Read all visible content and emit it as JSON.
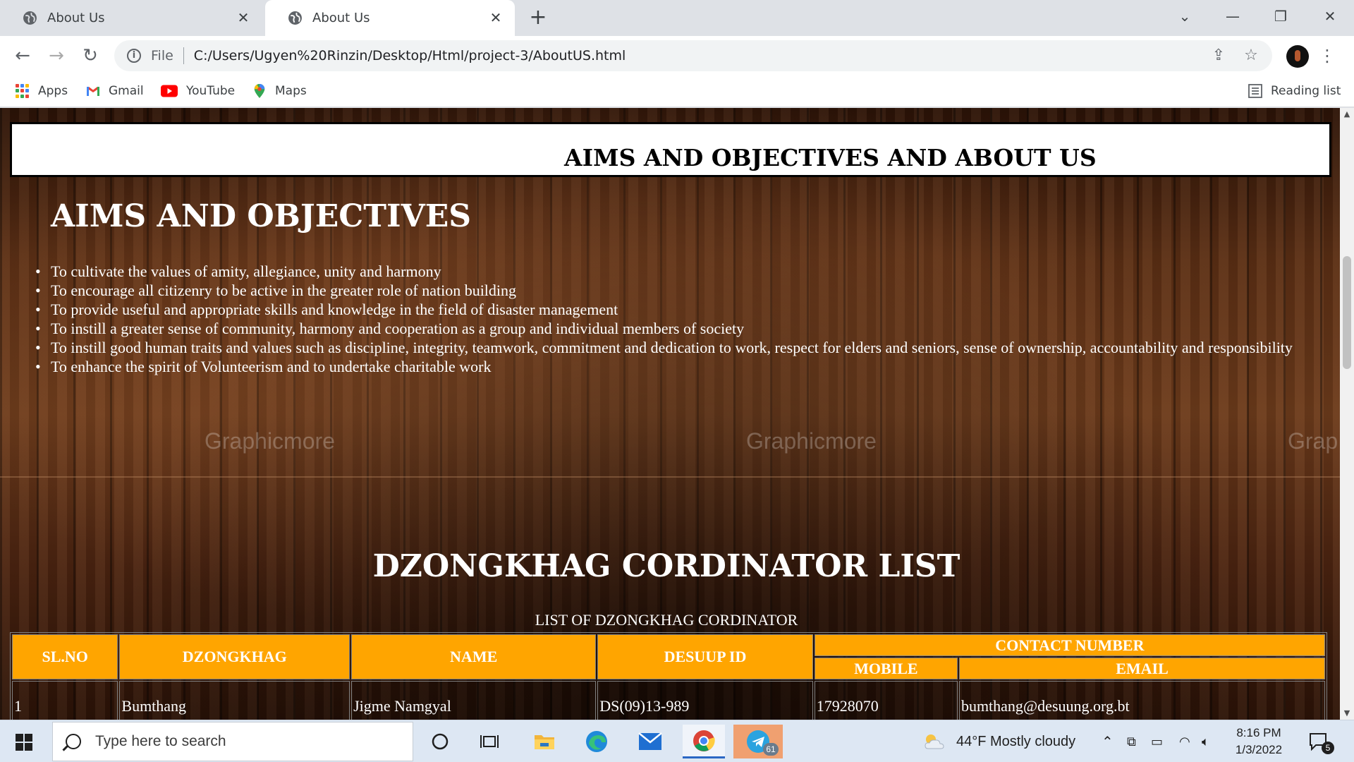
{
  "browser": {
    "tabs": [
      {
        "title": "About Us",
        "active": false
      },
      {
        "title": "About Us",
        "active": true
      }
    ],
    "new_tab_symbol": "+",
    "address": {
      "scheme": "File",
      "url": "C:/Users/Ugyen%20Rinzin/Desktop/Html/project-3/AboutUS.html"
    },
    "bookmarks": [
      "Apps",
      "Gmail",
      "YouTube",
      "Maps"
    ],
    "reading_list": "Reading list"
  },
  "page": {
    "header_banner": "AIMS AND OBJECTIVES AND ABOUT US",
    "aims_title": "AIMS AND OBJECTIVES",
    "aims": [
      "To cultivate the values of amity, allegiance, unity and harmony",
      "To encourage all citizenry to be active in the greater role of nation building",
      "To provide useful and appropriate skills and knowledge in the field of disaster management",
      "To instill a greater sense of community, harmony and cooperation as a group and individual members of society",
      "To instill good human traits and values such as discipline, integrity, teamwork, commitment and dedication to work, respect for elders and seniors, sense of ownership, accountability and responsibility",
      "To enhance the spirit of Volunteerism and to undertake charitable work"
    ],
    "watermarks": [
      "Graphicmore",
      "Graphicmore",
      "Grap"
    ],
    "list_title": "DZONGKHAG CORDINATOR LIST",
    "table": {
      "caption": "LIST OF DZONGKHAG CORDINATOR",
      "headers": {
        "sl": "SL.NO",
        "dzongkhag": "DZONGKHAG",
        "name": "NAME",
        "desuup_id": "DESUUP ID",
        "contact": "CONTACT NUMBER",
        "mobile": "MOBILE",
        "email": "EMAIL"
      },
      "rows": [
        [
          "1",
          "Bumthang",
          "Jigme Namgyal",
          "DS(09)13-989",
          "17928070",
          "bumthang@desuung.org.bt"
        ]
      ],
      "header_color": "#ffa500"
    }
  },
  "taskbar": {
    "search_placeholder": "Type here to search",
    "weather": "44°F  Mostly cloudy",
    "time": "8:16 PM",
    "date": "1/3/2022",
    "telegram_badge": "61",
    "notification_count": "5"
  }
}
